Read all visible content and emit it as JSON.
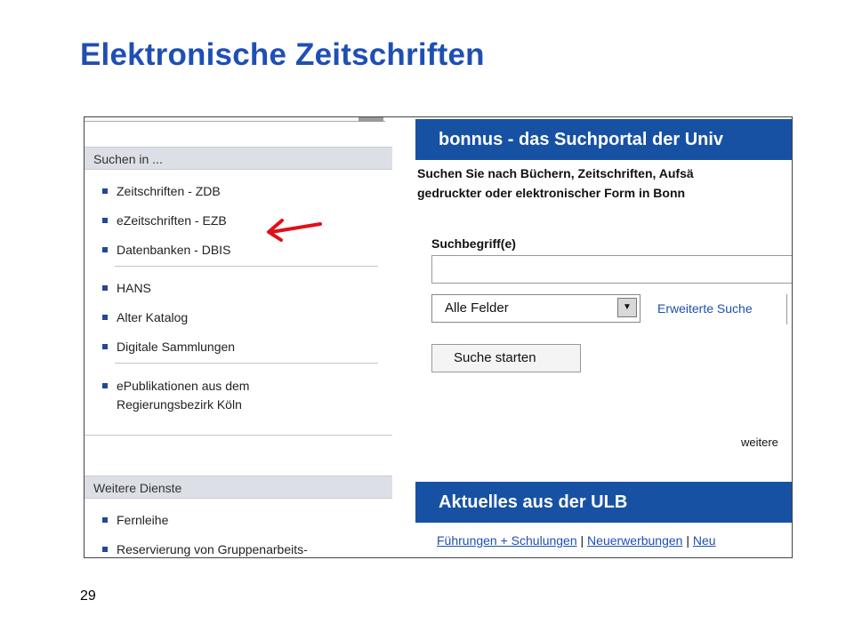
{
  "slide": {
    "title": "Elektronische Zeitschriften",
    "page_number": "29"
  },
  "sidebar": {
    "search_header": "Suchen in ...",
    "search_items": [
      {
        "label": "Zeitschriften - ZDB"
      },
      {
        "label": "eZeitschriften - EZB"
      },
      {
        "label": "Datenbanken - DBIS"
      }
    ],
    "catalog_items": [
      {
        "label": "HANS"
      },
      {
        "label": "Alter Katalog"
      },
      {
        "label": "Digitale Sammlungen"
      }
    ],
    "epub_item": {
      "line1": "ePublikationen aus dem",
      "line2": "Regierungsbezirk Köln"
    },
    "services_header": "Weitere Dienste",
    "service_items": [
      {
        "label": "Fernleihe"
      },
      {
        "label": "Reservierung von Gruppenarbeits-"
      }
    ]
  },
  "main": {
    "banner_title": "bonnus - das Suchportal der Univ",
    "intro_line1": "Suchen Sie nach Büchern, Zeitschriften, Aufsä",
    "intro_line2": "gedruckter oder elektronischer Form in Bonn",
    "search_label": "Suchbegriff(e)",
    "search_value": "",
    "field_select_value": "Alle Felder",
    "advanced_search_link": "Erweiterte Suche",
    "submit_button": "Suche starten",
    "more_link": "weitere",
    "news_banner_title": "Aktuelles aus der ULB",
    "news_links": [
      "Führungen + Schulungen",
      "Neuerwerbungen",
      "Neu"
    ],
    "news_separator": "|"
  },
  "colors": {
    "title_blue": "#1f4fb4",
    "banner_blue": "#1751a4",
    "sidebar_header_bg": "#dcdfe6",
    "bullet_blue": "#22479a",
    "annotation_arrow": "#e0101a"
  },
  "icons": {
    "annotation": "red-arrow-icon",
    "select_toggle": "chevron-down-icon",
    "list_marker": "square-bullet-icon"
  }
}
